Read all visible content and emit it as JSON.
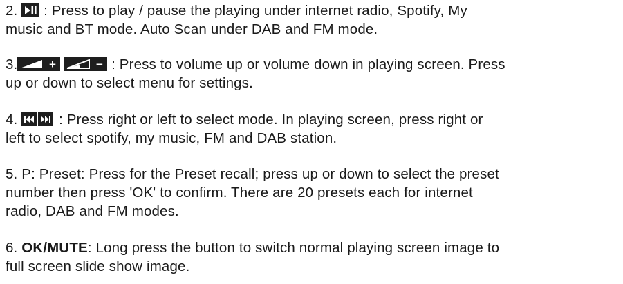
{
  "items": [
    {
      "number": "2.",
      "icon": "play-pause-icon",
      "line1_text": " : Press to play / pause the playing under internet radio, Spotify, My",
      "line2_text": "music and BT mode. Auto Scan under DAB and FM mode."
    },
    {
      "number": "3.",
      "icon_up": "volume-up-icon",
      "icon_up_sign": "+",
      "icon_down": "volume-down-icon",
      "icon_down_sign": "−",
      "line1_text": " :  Press to volume up or volume down in playing screen. Press",
      "line2_text": "up or down to select menu for settings."
    },
    {
      "number": "4.",
      "icon_prev": "skip-back-icon",
      "icon_next": "skip-forward-icon",
      "line1_text": " : Press right or left to select mode. In playing screen, press right or",
      "line2_text": "left to select spotify, my music, FM and DAB station."
    },
    {
      "number": "5.",
      "line1_text": "P: Preset: Press for the Preset recall; press up or down to select the preset",
      "line2_text": "number then press 'OK' to confirm. There are 20 presets each for internet",
      "line3_text": "radio, DAB and FM modes."
    },
    {
      "number": "6.",
      "bold_label": "OK/MUTE",
      "line1_text": ": Long press the button to switch normal playing screen image to",
      "line2_text": "full screen slide show image."
    }
  ]
}
